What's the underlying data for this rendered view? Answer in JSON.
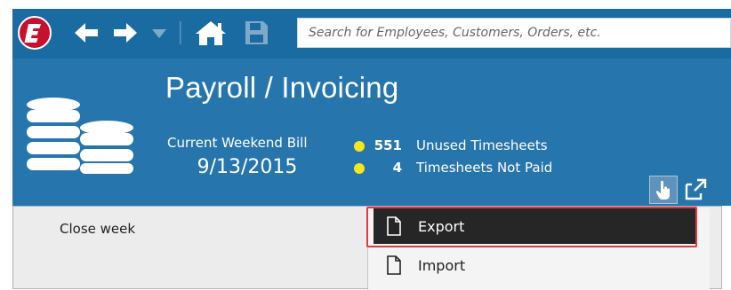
{
  "toolbar": {
    "logo_letter": "E",
    "back_icon": "arrow-left-icon",
    "forward_icon": "arrow-right-icon",
    "history_icon": "chevron-down-icon",
    "home_icon": "home-icon",
    "save_icon": "save-icon",
    "search_placeholder": "Search for Employees, Customers, Orders, etc."
  },
  "header": {
    "icon": "stack-icon",
    "title": "Payroll / Invoicing",
    "bill_label": "Current Weekend Bill",
    "bill_date": "9/13/2015",
    "stats": [
      {
        "count": "551",
        "label": "Unused Timesheets"
      },
      {
        "count": "4",
        "label": "Timesheets Not Paid"
      }
    ],
    "actions": [
      "hand-pointer-icon",
      "popout-icon"
    ]
  },
  "content": {
    "close_week_label": "Close week",
    "menu": [
      {
        "label": "Export",
        "icon": "document-icon",
        "selected": true
      },
      {
        "label": "Import",
        "icon": "document-icon",
        "selected": false
      }
    ]
  },
  "colors": {
    "toolbar_bg": "#1b6ba3",
    "header_bg": "#2775ad",
    "logo_red": "#c8102e",
    "stat_dot": "#f5e61e",
    "selected_bg": "#262626",
    "highlight": "#e23a3a"
  }
}
